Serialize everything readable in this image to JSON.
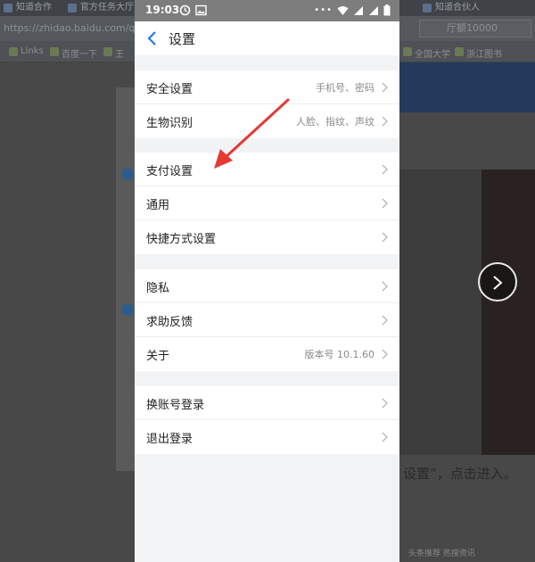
{
  "background": {
    "tabs": [
      "知道合作",
      "官方任务大厅",
      "知道合伙人"
    ],
    "url": "https://zhidao.baidu.com/q",
    "search_text": "厅额10000",
    "bookmarks": [
      "Links",
      "百度一下",
      "王",
      "全国大学",
      "浙江图书"
    ],
    "footer_text": "设置”，点击进入。",
    "bottom_bar": "头条推荐   热搜资讯"
  },
  "statusbar": {
    "time": "19:03"
  },
  "header": {
    "title": "设置"
  },
  "groups": [
    {
      "items": [
        {
          "label": "安全设置",
          "value": "手机号、密码"
        },
        {
          "label": "生物识别",
          "value": "人脸、指纹、声纹"
        }
      ]
    },
    {
      "items": [
        {
          "label": "支付设置",
          "value": ""
        },
        {
          "label": "通用",
          "value": ""
        },
        {
          "label": "快捷方式设置",
          "value": ""
        }
      ]
    },
    {
      "items": [
        {
          "label": "隐私",
          "value": ""
        },
        {
          "label": "求助反馈",
          "value": ""
        },
        {
          "label": "关于",
          "value": "版本号 10.1.60"
        }
      ]
    },
    {
      "items": [
        {
          "label": "换账号登录",
          "value": ""
        },
        {
          "label": "退出登录",
          "value": ""
        }
      ]
    }
  ],
  "colors": {
    "accent": "#1a73e8",
    "annotation_arrow": "#e53935"
  }
}
